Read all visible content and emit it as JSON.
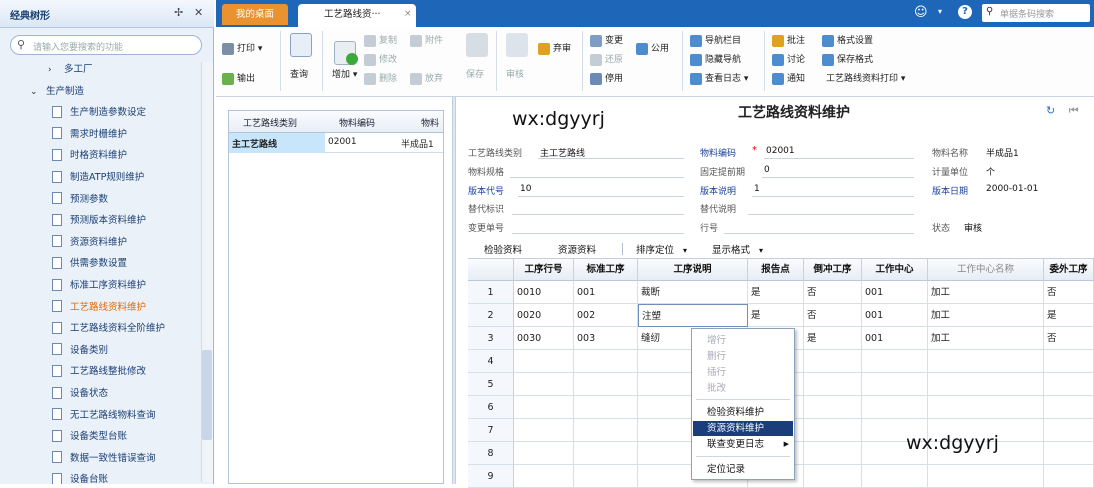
{
  "sidebar": {
    "title": "经典树形",
    "pin_icon": "pin-icon",
    "close_icon": "close-icon",
    "search_placeholder": "请输入您要搜索的功能",
    "items": [
      {
        "label": "多工厂",
        "type": "node",
        "expanded": false
      },
      {
        "label": "生产制造",
        "type": "node",
        "expanded": true
      },
      {
        "label": "生产制造参数设定",
        "type": "leaf"
      },
      {
        "label": "需求时栅维护",
        "type": "leaf"
      },
      {
        "label": "时格资料维护",
        "type": "leaf"
      },
      {
        "label": "制造ATP规则维护",
        "type": "leaf"
      },
      {
        "label": "预测参数",
        "type": "leaf"
      },
      {
        "label": "预测版本资料维护",
        "type": "leaf"
      },
      {
        "label": "资源资料维护",
        "type": "leaf"
      },
      {
        "label": "供需参数设置",
        "type": "leaf"
      },
      {
        "label": "标准工序资料维护",
        "type": "leaf"
      },
      {
        "label": "工艺路线资料维护",
        "type": "leaf",
        "active": true
      },
      {
        "label": "工艺路线资料全阶维护",
        "type": "leaf"
      },
      {
        "label": "设备类别",
        "type": "leaf"
      },
      {
        "label": "工艺路线整批修改",
        "type": "leaf"
      },
      {
        "label": "设备状态",
        "type": "leaf"
      },
      {
        "label": "无工艺路线物料查询",
        "type": "leaf"
      },
      {
        "label": "设备类型台账",
        "type": "leaf"
      },
      {
        "label": "数据一致性错误查询",
        "type": "leaf"
      },
      {
        "label": "设备台账",
        "type": "leaf"
      }
    ]
  },
  "tabs": {
    "desktop": "我的桌面",
    "current": "工艺路线资···",
    "close": "×"
  },
  "topbar": {
    "user_icon": "face-icon",
    "help_icon": "help-icon",
    "search_placeholder": "单据条码搜索"
  },
  "toolbar": {
    "print": "打印",
    "output": "输出",
    "query": "查询",
    "add": "增加",
    "copy": "复制",
    "modify": "修改",
    "delete": "删除",
    "attach": "附件",
    "abandon": "放弃",
    "save": "保存",
    "audit": "审核",
    "unaudit": "弃审",
    "change": "变更",
    "restore": "还原",
    "disable": "停用",
    "common": "公用",
    "nav_bar": "导航栏目",
    "hide_nav": "隐藏导航",
    "view_log": "查看日志",
    "annotate": "批注",
    "discuss": "讨论",
    "notify": "通知",
    "format_set": "格式设置",
    "save_format": "保存格式",
    "route_print": "工艺路线资料打印"
  },
  "left_grid": {
    "headers": [
      "工艺路线类别",
      "物料编码",
      "物料"
    ],
    "row": [
      "主工艺路线",
      "02001",
      "半成品1"
    ]
  },
  "watermark": "wx:dgyyrj",
  "form": {
    "title": "工艺路线资料维护",
    "fields": {
      "route_type_label": "工艺路线类别",
      "route_type_value": "主工艺路线",
      "material_code_label": "物料编码",
      "material_code_value": "02001",
      "material_name_label": "物料名称",
      "material_name_value": "半成品1",
      "material_spec_label": "物料规格",
      "fixed_lead_label": "固定提前期",
      "fixed_lead_value": "0",
      "unit_label": "计量单位",
      "unit_value": "个",
      "version_code_label": "版本代号",
      "version_code_value": "10",
      "version_desc_label": "版本说明",
      "version_desc_value": "1",
      "version_date_label": "版本日期",
      "version_date_value": "2000-01-01",
      "alt_flag_label": "替代标识",
      "alt_desc_label": "替代说明",
      "change_no_label": "变更单号",
      "line_no_label": "行号",
      "status_label": "状态",
      "status_value": "审核"
    }
  },
  "subtabs": {
    "inspect": "检验资料",
    "resource": "资源资料",
    "sort": "排序定位",
    "display": "显示格式"
  },
  "detail_grid": {
    "headers": [
      "工序行号",
      "标准工序",
      "工序说明",
      "报告点",
      "倒冲工序",
      "工作中心",
      "工作中心名称",
      "委外工序"
    ],
    "rows": [
      {
        "n": "1",
        "cells": [
          "0010",
          "001",
          "裁断",
          "是",
          "否",
          "001",
          "加工",
          "否"
        ]
      },
      {
        "n": "2",
        "cells": [
          "0020",
          "002",
          "注塑",
          "是",
          "否",
          "001",
          "加工",
          "是"
        ]
      },
      {
        "n": "3",
        "cells": [
          "0030",
          "003",
          "缝纫",
          "",
          "是",
          "001",
          "加工",
          "否"
        ]
      },
      {
        "n": "4",
        "cells": [
          "",
          "",
          "",
          "",
          "",
          "",
          "",
          ""
        ]
      },
      {
        "n": "5",
        "cells": [
          "",
          "",
          "",
          "",
          "",
          "",
          "",
          ""
        ]
      },
      {
        "n": "6",
        "cells": [
          "",
          "",
          "",
          "",
          "",
          "",
          "",
          ""
        ]
      },
      {
        "n": "7",
        "cells": [
          "",
          "",
          "",
          "",
          "",
          "",
          "",
          ""
        ]
      },
      {
        "n": "8",
        "cells": [
          "",
          "",
          "",
          "",
          "",
          "",
          "",
          ""
        ]
      },
      {
        "n": "9",
        "cells": [
          "",
          "",
          "",
          "",
          "",
          "",
          "",
          ""
        ]
      }
    ]
  },
  "context_menu": {
    "items": [
      {
        "label": "增行",
        "disabled": true
      },
      {
        "label": "删行",
        "disabled": true
      },
      {
        "label": "插行",
        "disabled": true
      },
      {
        "label": "批改",
        "disabled": true
      },
      {
        "label": "检验资料维护",
        "disabled": false
      },
      {
        "label": "资源资料维护",
        "disabled": false,
        "selected": true
      },
      {
        "label": "联查变更日志",
        "disabled": false,
        "submenu": true
      },
      {
        "label": "定位记录",
        "disabled": false
      }
    ]
  },
  "colors": {
    "tabbar": "#1e67b8",
    "desktop_tab": "#e9922f",
    "selection": "#1a3d7c",
    "active_tree": "#e46a00"
  }
}
